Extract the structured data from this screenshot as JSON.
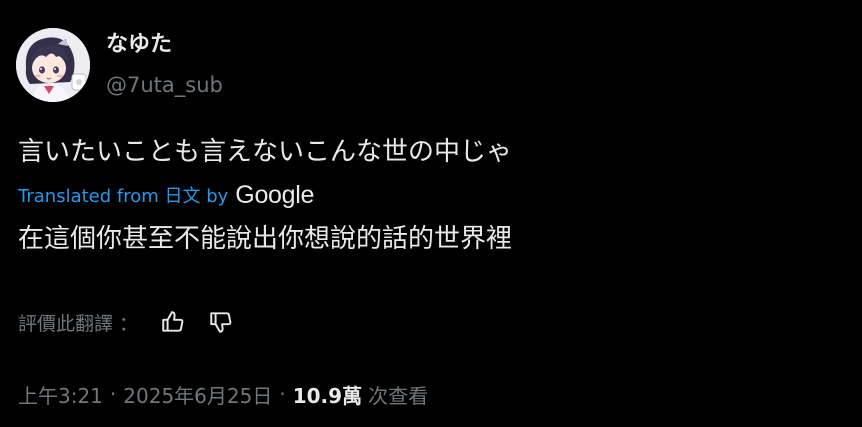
{
  "author": {
    "display_name": "なゆた",
    "handle": "@7uta_sub",
    "avatar_icon": "avatar-anime-girl-icon"
  },
  "post": {
    "original_text": "言いたいことも言えないこんな世の中じゃ",
    "translation": {
      "prefix": "Translated from 日文 by",
      "provider": "Google",
      "text": "在這個你甚至不能說出你想說的話的世界裡"
    }
  },
  "rate": {
    "label": "評價此翻譯",
    "colon": "：",
    "thumbs_up_icon": "thumbs-up-icon",
    "thumbs_down_icon": "thumbs-down-icon"
  },
  "meta": {
    "time": "上午3:21",
    "separator": "·",
    "date": "2025年6月25日",
    "views_count": "10.9萬",
    "views_label": "次查看"
  },
  "colors": {
    "background": "#000000",
    "primary_text": "#e7e9ea",
    "secondary_text": "#71767b",
    "link": "#1d9bf0"
  }
}
